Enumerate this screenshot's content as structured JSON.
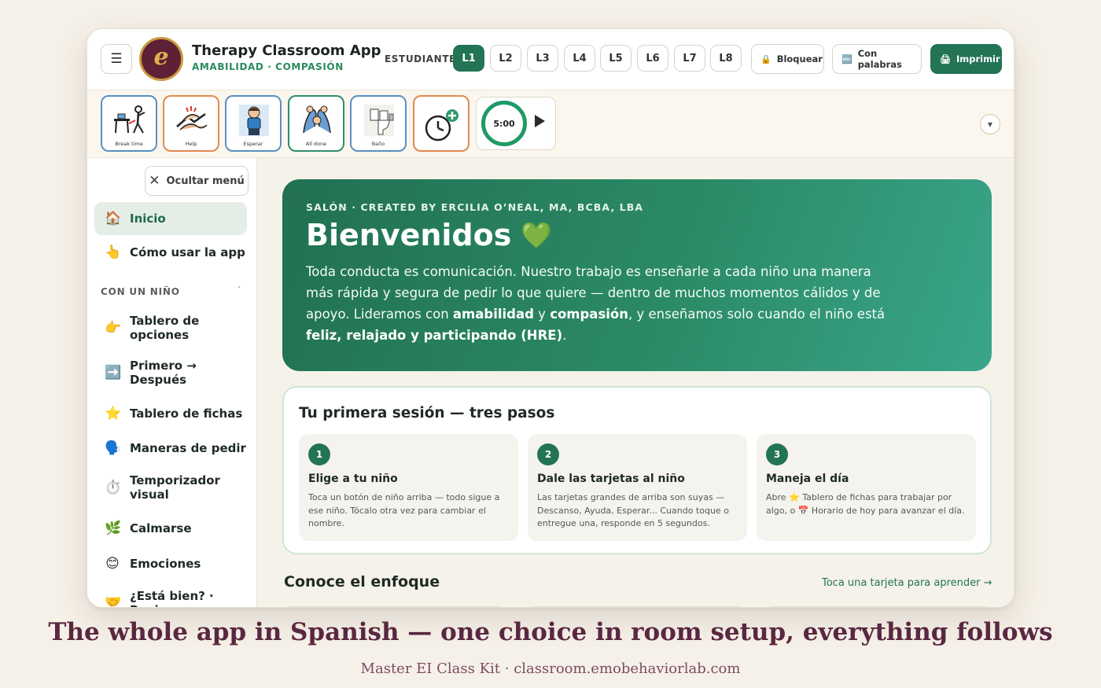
{
  "app": {
    "title": "Therapy Classroom App",
    "subtitle": "AMABILIDAD · COMPASIÓN",
    "logo_letter": "e",
    "colors": {
      "primary": "#237355",
      "accent_gold": "#c9973f",
      "logo_bg": "#5d2035",
      "hero_start": "#217052",
      "hero_end": "#3aa58a",
      "page_bg": "#f6f1e8"
    }
  },
  "header": {
    "menu_icon": "hamburger-icon",
    "student_label": "ESTUDIANTE",
    "levels": [
      "L1",
      "L2",
      "L3",
      "L4",
      "L5",
      "L6",
      "L7",
      "L8"
    ],
    "active_level": "L1",
    "lock_label": "Bloquear",
    "lock_icon": "lock-icon",
    "words_label": "Con palabras",
    "words_icon": "text-icon",
    "print_label": "Imprimir",
    "print_icon": "printer-icon"
  },
  "card_strip": {
    "cards": [
      {
        "caption": "Break time",
        "icon": "break-time-icon"
      },
      {
        "caption": "Help",
        "icon": "help-hands-icon"
      },
      {
        "caption": "Esperar",
        "icon": "wait-child-icon"
      },
      {
        "caption": "All done",
        "icon": "all-done-icon"
      },
      {
        "caption": "Baño",
        "icon": "toilet-icon"
      },
      {
        "caption": "",
        "icon": "add-timer-icon"
      }
    ],
    "timer": {
      "value": "5:00",
      "play_icon": "play-icon"
    },
    "collapse_icon": "chevron-down-icon"
  },
  "sidebar": {
    "hide_label": "Ocultar menú",
    "top_items": [
      {
        "label": "Inicio",
        "icon": "house-icon",
        "emoji": "🏠"
      },
      {
        "label": "Cómo usar la app",
        "icon": "pointing-hand-icon",
        "emoji": "👆"
      }
    ],
    "section_label": "CON UN NIÑO",
    "items": [
      {
        "label": "Tablero de opciones",
        "icon": "pointing-right-icon",
        "emoji": "👉"
      },
      {
        "label": "Primero → Después",
        "icon": "arrow-right-icon",
        "emoji": "➡️"
      },
      {
        "label": "Tablero de fichas",
        "icon": "star-icon",
        "emoji": "⭐"
      },
      {
        "label": "Maneras de pedir",
        "icon": "speaking-head-icon",
        "emoji": "🗣️"
      },
      {
        "label": "Temporizador visual",
        "icon": "stopwatch-icon",
        "emoji": "⏱️"
      },
      {
        "label": "Calmarse",
        "icon": "herb-icon",
        "emoji": "🌿"
      },
      {
        "label": "Emociones",
        "icon": "smile-icon",
        "emoji": "😊"
      },
      {
        "label": "¿Está bien? · Revisar",
        "icon": "handshake-icon",
        "emoji": "🤝"
      }
    ]
  },
  "hero": {
    "kicker": "SALÓN · CREATED BY ERCILIA O’NEAL, MA, BCBA, LBA",
    "title": "Bienvenidos",
    "heart": "💚",
    "body_1": "Toda conducta es comunicación. Nuestro trabajo es enseñarle a cada niño una manera más rápida y segura de pedir lo que quiere — dentro de muchos momentos cálidos y de apoyo. Lideramos con ",
    "bold_1": "amabilidad",
    "body_2": " y ",
    "bold_2": "compasión",
    "body_3": ", y enseñamos solo cuando el niño está ",
    "bold_3": "feliz, relajado y participando (HRE)",
    "body_4": "."
  },
  "first_session": {
    "title": "Tu primera sesión — tres pasos",
    "steps": [
      {
        "num": "1",
        "title": "Elige a tu niño",
        "body": "Toca un botón de niño arriba — todo sigue a ese niño. Tócalo otra vez para cambiar el nombre."
      },
      {
        "num": "2",
        "title": "Dale las tarjetas al niño",
        "body": "Las tarjetas grandes de arriba son suyas — Descanso, Ayuda, Esperar... Cuando toque o entregue una, responde en 5 segundos."
      },
      {
        "num": "3",
        "title": "Maneja el día",
        "body": "Abre ⭐ Tablero de fichas para trabajar por algo, o 📅 Horario de hoy para avanzar el día."
      }
    ]
  },
  "approach": {
    "title": "Conoce el enfoque",
    "link": "Toca una tarjeta para aprender →"
  },
  "caption": {
    "headline": "The whole app in Spanish — one choice in room setup, everything follows",
    "footer": "Master EI Class Kit · classroom.emobehaviorlab.com"
  }
}
